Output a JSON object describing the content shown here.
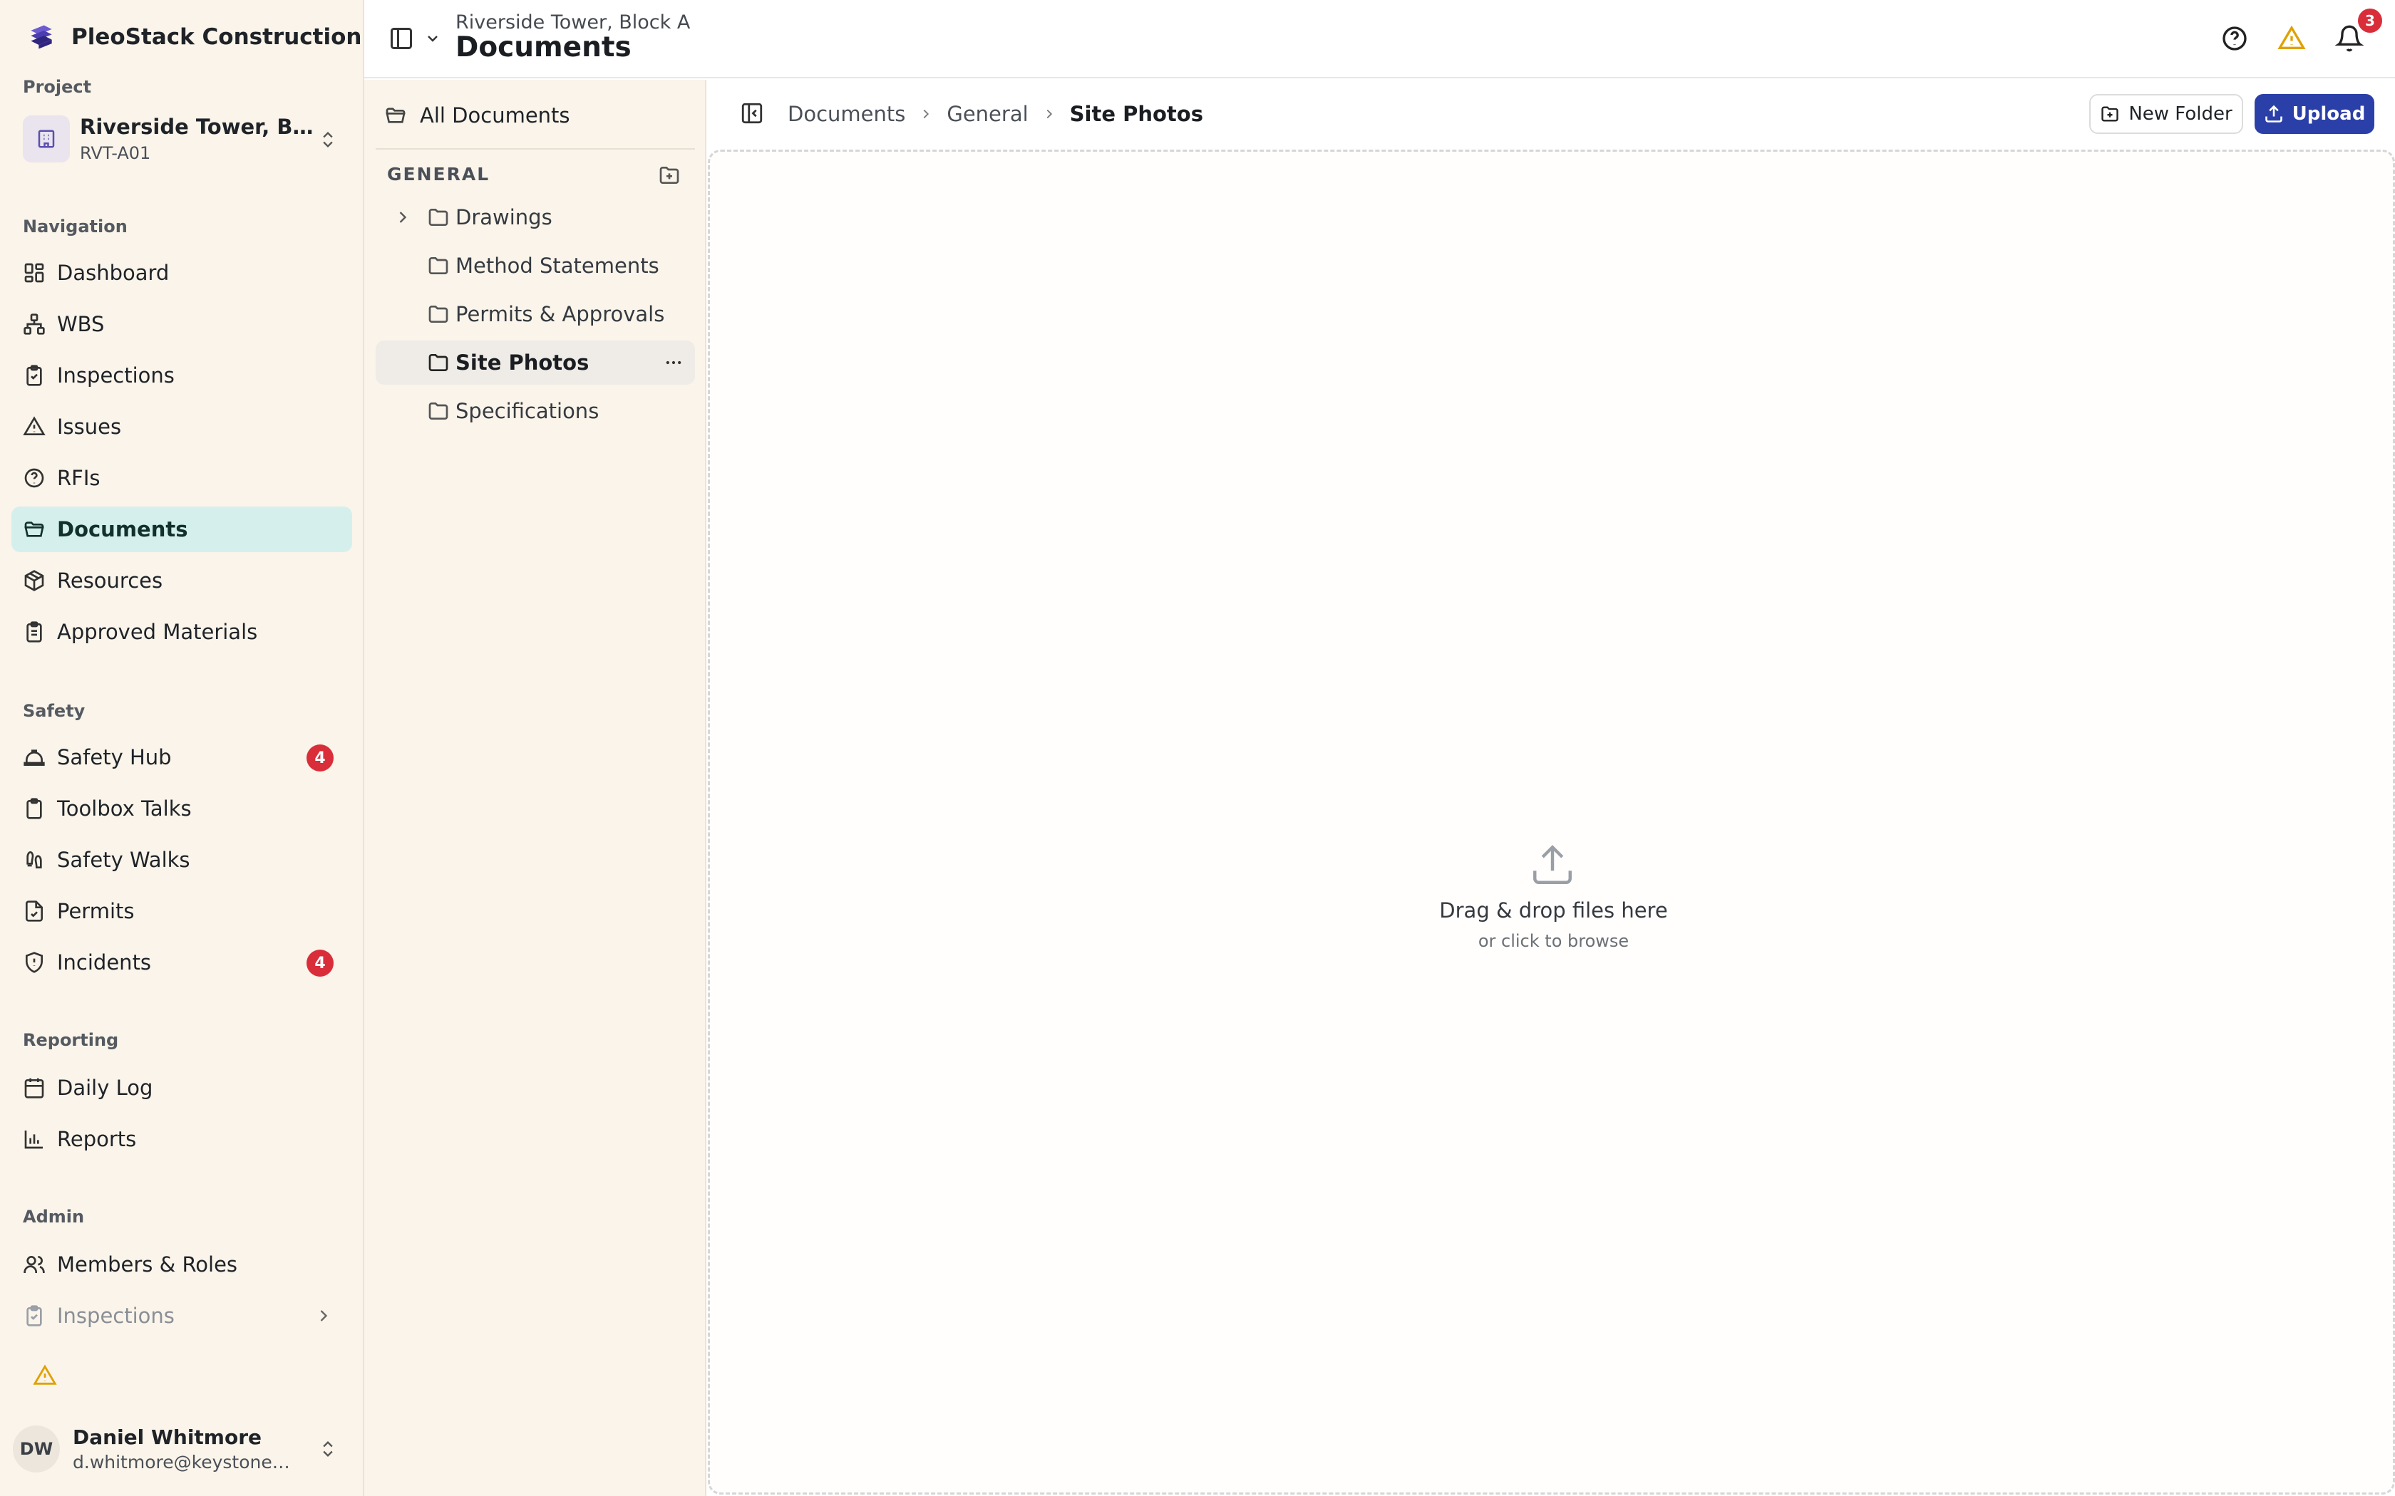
{
  "app": {
    "brand_name": "PleoStack Construction ..."
  },
  "sidebar": {
    "project_section": "Project",
    "project": {
      "name": "Riverside Tower, Bloc...",
      "code": "RVT-A01"
    },
    "sections": [
      {
        "label": "Navigation",
        "items": [
          {
            "label": "Dashboard",
            "icon": "dashboard-icon"
          },
          {
            "label": "WBS",
            "icon": "hierarchy-icon"
          },
          {
            "label": "Inspections",
            "icon": "clipboard-check-icon"
          },
          {
            "label": "Issues",
            "icon": "warning-triangle-icon"
          },
          {
            "label": "RFIs",
            "icon": "help-circle-icon"
          },
          {
            "label": "Documents",
            "icon": "folder-open-icon",
            "active": true
          },
          {
            "label": "Resources",
            "icon": "package-icon"
          },
          {
            "label": "Approved Materials",
            "icon": "clipboard-list-icon"
          }
        ]
      },
      {
        "label": "Safety",
        "items": [
          {
            "label": "Safety Hub",
            "icon": "hard-hat-icon",
            "badge": "4"
          },
          {
            "label": "Toolbox Talks",
            "icon": "clipboard-icon"
          },
          {
            "label": "Safety Walks",
            "icon": "footprints-icon"
          },
          {
            "label": "Permits",
            "icon": "file-check-icon"
          },
          {
            "label": "Incidents",
            "icon": "shield-alert-icon",
            "badge": "4"
          }
        ]
      },
      {
        "label": "Reporting",
        "items": [
          {
            "label": "Daily Log",
            "icon": "calendar-icon"
          },
          {
            "label": "Reports",
            "icon": "bar-chart-icon"
          }
        ]
      },
      {
        "label": "Admin",
        "items": [
          {
            "label": "Members & Roles",
            "icon": "users-icon"
          },
          {
            "label": "Inspections",
            "icon": "clipboard-check-icon",
            "muted": true
          }
        ]
      }
    ],
    "user": {
      "initials": "DW",
      "name": "Daniel Whitmore",
      "email": "d.whitmore@keystonebuil..."
    }
  },
  "header": {
    "subtitle": "Riverside Tower, Block A",
    "title": "Documents",
    "notification_count": "3",
    "colors": {
      "warning": "#e0a100",
      "badge": "#d92d3a"
    }
  },
  "folders": {
    "all_documents": "All Documents",
    "group_label": "GENERAL",
    "items": [
      {
        "label": "Drawings",
        "expandable": true
      },
      {
        "label": "Method Statements"
      },
      {
        "label": "Permits & Approvals"
      },
      {
        "label": "Site Photos",
        "active": true
      },
      {
        "label": "Specifications"
      }
    ]
  },
  "main": {
    "breadcrumb": [
      "Documents",
      "General",
      "Site Photos"
    ],
    "new_folder_label": "New Folder",
    "upload_label": "Upload",
    "dropzone": {
      "title": "Drag & drop files here",
      "subtitle": "or click to browse"
    },
    "colors": {
      "primary": "#2b3fa8",
      "active_nav": "#d5f0ec"
    }
  }
}
